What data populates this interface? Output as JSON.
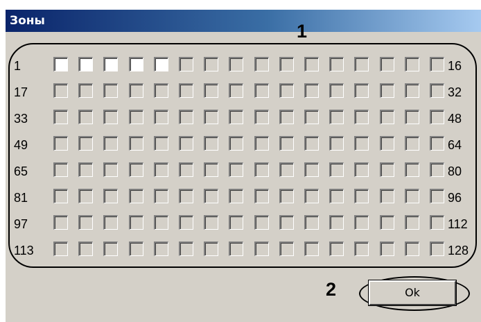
{
  "window": {
    "title": "Зоны"
  },
  "callouts": {
    "one": "1",
    "two": "2"
  },
  "rows": [
    {
      "left": "1",
      "right": "16",
      "checked": [
        true,
        true,
        true,
        true,
        true,
        false,
        false,
        false,
        false,
        false,
        false,
        false,
        false,
        false,
        false,
        false
      ]
    },
    {
      "left": "17",
      "right": "32",
      "checked": [
        false,
        false,
        false,
        false,
        false,
        false,
        false,
        false,
        false,
        false,
        false,
        false,
        false,
        false,
        false,
        false
      ]
    },
    {
      "left": "33",
      "right": "48",
      "checked": [
        false,
        false,
        false,
        false,
        false,
        false,
        false,
        false,
        false,
        false,
        false,
        false,
        false,
        false,
        false,
        false
      ]
    },
    {
      "left": "49",
      "right": "64",
      "checked": [
        false,
        false,
        false,
        false,
        false,
        false,
        false,
        false,
        false,
        false,
        false,
        false,
        false,
        false,
        false,
        false
      ]
    },
    {
      "left": "65",
      "right": "80",
      "checked": [
        false,
        false,
        false,
        false,
        false,
        false,
        false,
        false,
        false,
        false,
        false,
        false,
        false,
        false,
        false,
        false
      ]
    },
    {
      "left": "81",
      "right": "96",
      "checked": [
        false,
        false,
        false,
        false,
        false,
        false,
        false,
        false,
        false,
        false,
        false,
        false,
        false,
        false,
        false,
        false
      ]
    },
    {
      "left": "97",
      "right": "112",
      "checked": [
        false,
        false,
        false,
        false,
        false,
        false,
        false,
        false,
        false,
        false,
        false,
        false,
        false,
        false,
        false,
        false
      ]
    },
    {
      "left": "113",
      "right": "128",
      "checked": [
        false,
        false,
        false,
        false,
        false,
        false,
        false,
        false,
        false,
        false,
        false,
        false,
        false,
        false,
        false,
        false
      ]
    }
  ],
  "buttons": {
    "ok_label": "Ok"
  }
}
